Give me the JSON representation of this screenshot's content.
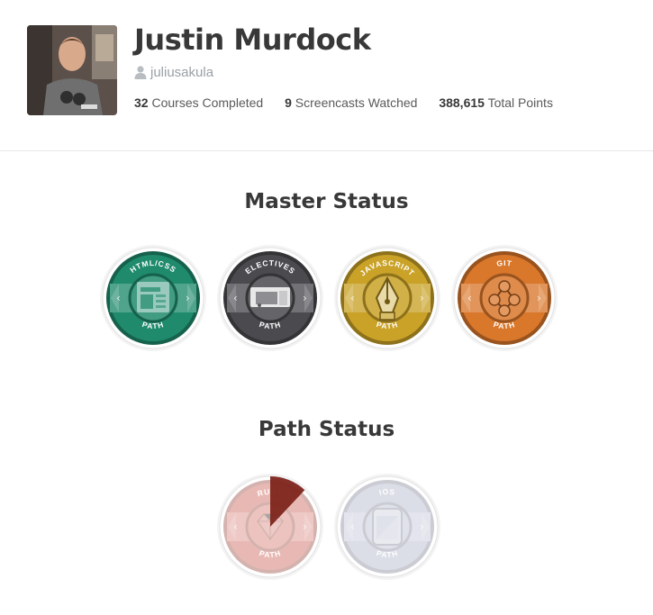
{
  "profile": {
    "name": "Justin Murdock",
    "username": "juliusakula",
    "stats": [
      {
        "value": "32",
        "label": "Courses Completed"
      },
      {
        "value": "9",
        "label": "Screencasts Watched"
      },
      {
        "value": "388,615",
        "label": "Total Points"
      }
    ]
  },
  "master_status": {
    "title": "Master Status",
    "badges": [
      {
        "top": "HTML/CSS",
        "bottom": "PATH",
        "icon": "html-css-icon",
        "color": "#1f8a6c"
      },
      {
        "top": "ELECTIVES",
        "bottom": "PATH",
        "icon": "electives-icon",
        "color": "#4a4a4f"
      },
      {
        "top": "JAVASCRIPT",
        "bottom": "PATH",
        "icon": "javascript-pen-icon",
        "color": "#c9a227"
      },
      {
        "top": "GIT",
        "bottom": "PATH",
        "icon": "git-icon",
        "color": "#d9772b"
      }
    ]
  },
  "path_status": {
    "title": "Path Status",
    "badges": [
      {
        "top": "RUBY",
        "bottom": "PATH",
        "icon": "ruby-icon",
        "color": "#c0392b",
        "progress": 0.12
      },
      {
        "top": "IOS",
        "bottom": "PATH",
        "icon": "ios-icon",
        "color": "#9aa0bd",
        "progress": 0
      }
    ]
  }
}
